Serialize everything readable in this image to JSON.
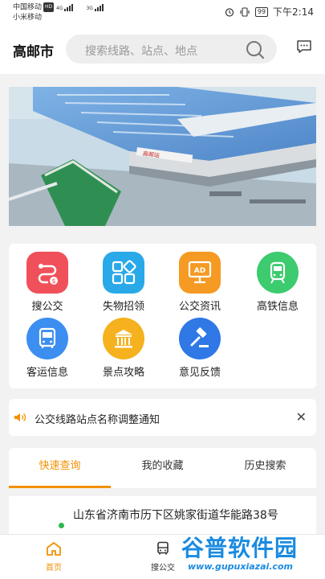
{
  "status_bar": {
    "carrier1": "中国移动",
    "carrier1_badge": "HD",
    "carrier2": "小米移动",
    "net1": "4G",
    "net2": "3G",
    "battery": "99",
    "time": "下午2:14"
  },
  "header": {
    "city": "高邮市",
    "search_placeholder": "搜索线路、站点、地点"
  },
  "banner": {
    "sign_text": "高邮站"
  },
  "services": [
    {
      "label": "搜公交",
      "icon": "bus-route-icon",
      "color": "#f0505a"
    },
    {
      "label": "失物招领",
      "icon": "lost-found-icon",
      "color": "#29a9e8"
    },
    {
      "label": "公交资讯",
      "icon": "ad-board-icon",
      "color": "#f59a23"
    },
    {
      "label": "高铁信息",
      "icon": "train-icon",
      "color": "#3ccb6e"
    },
    {
      "label": "客运信息",
      "icon": "coach-bus-icon",
      "color": "#3c8ef0"
    },
    {
      "label": "景点攻略",
      "icon": "temple-icon",
      "color": "#f5b21e"
    },
    {
      "label": "意见反馈",
      "icon": "gavel-icon",
      "color": "#2f78e6"
    }
  ],
  "notice": {
    "text": "公交线路站点名称调整通知",
    "close": "✕"
  },
  "tabs": [
    {
      "label": "快速查询",
      "active": true
    },
    {
      "label": "我的收藏",
      "active": false
    },
    {
      "label": "历史搜索",
      "active": false
    }
  ],
  "result": {
    "address": "山东省济南市历下区姚家街道华能路38号"
  },
  "bottom_nav": [
    {
      "label": "首页",
      "icon": "home-icon",
      "active": true
    },
    {
      "label": "搜公交",
      "icon": "bus-icon",
      "active": false
    }
  ],
  "watermark": {
    "title": "谷普软件园",
    "url": "www.gupuxiazai.com"
  },
  "colors": {
    "accent": "#f29000",
    "dot": "#2fb84a"
  }
}
